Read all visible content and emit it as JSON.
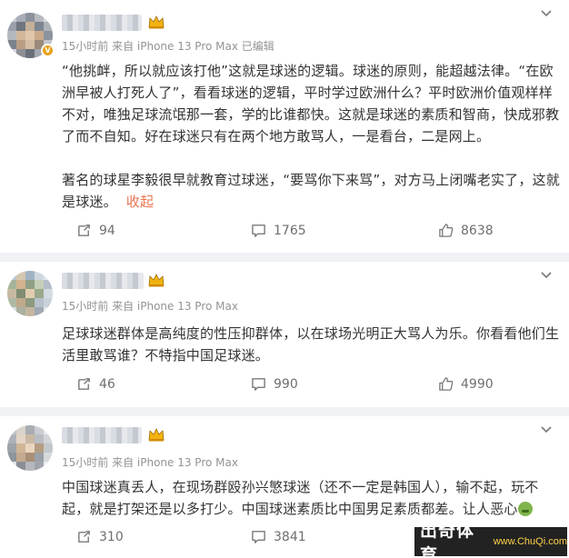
{
  "posts": [
    {
      "meta": "15小时前 来自 iPhone 13 Pro Max 已编辑",
      "paragraphs": [
        "“他挑衅，所以就应该打他”这就是球迷的逻辑。球迷的原则，能超越法律。“在欧洲早被人打死人了”，看看球迷的逻辑，平时学过欧洲什么？平时欧洲价值观样样不对，唯独足球流氓那一套，学的比谁都快。这就是球迷的素质和智商，快成邪教了而不自知。好在球迷只有在两个地方敢骂人，一是看台，二是网上。",
        "著名的球星李毅很早就教育过球迷，“要骂你下来骂”，对方马上闭嘴老实了，这就是球迷。"
      ],
      "collapse_label": "收起",
      "repost_count": "94",
      "comment_count": "1765",
      "like_count": "8638"
    },
    {
      "meta": "15小时前 来自 iPhone 13 Pro Max",
      "paragraphs": [
        "足球球迷群体是高纯度的性压抑群体，以在球场光明正大骂人为乐。你看看他们生活里敢骂谁？不特指中国足球迷。"
      ],
      "repost_count": "46",
      "comment_count": "990",
      "like_count": "4990"
    },
    {
      "meta": "15小时前 来自 iPhone 13 Pro Max",
      "paragraphs": [
        "中国球迷真丢人，在现场群殴孙兴慜球迷（还不一定是韩国人），输不起，玩不起，就是打架还是以多打少。中国球迷素质比中国男足素质都差。让人恶心"
      ],
      "repost_count": "310",
      "comment_count": "3841",
      "like_count": ""
    }
  ],
  "icons": {
    "repost": "repost-icon",
    "comment": "comment-icon",
    "like": "like-icon",
    "menu": "chevron-down-icon",
    "verified": "verified-badge-icon",
    "vip": "crown-icon",
    "emoji": "disgust-emoji-icon"
  },
  "watermark": {
    "cn": "出奇体育",
    "en": "www.ChuQi.com"
  },
  "colors": {
    "link": "#eb7350",
    "meta": "#939393",
    "divider": "#f1f2f5",
    "crown": "#f2b312"
  }
}
